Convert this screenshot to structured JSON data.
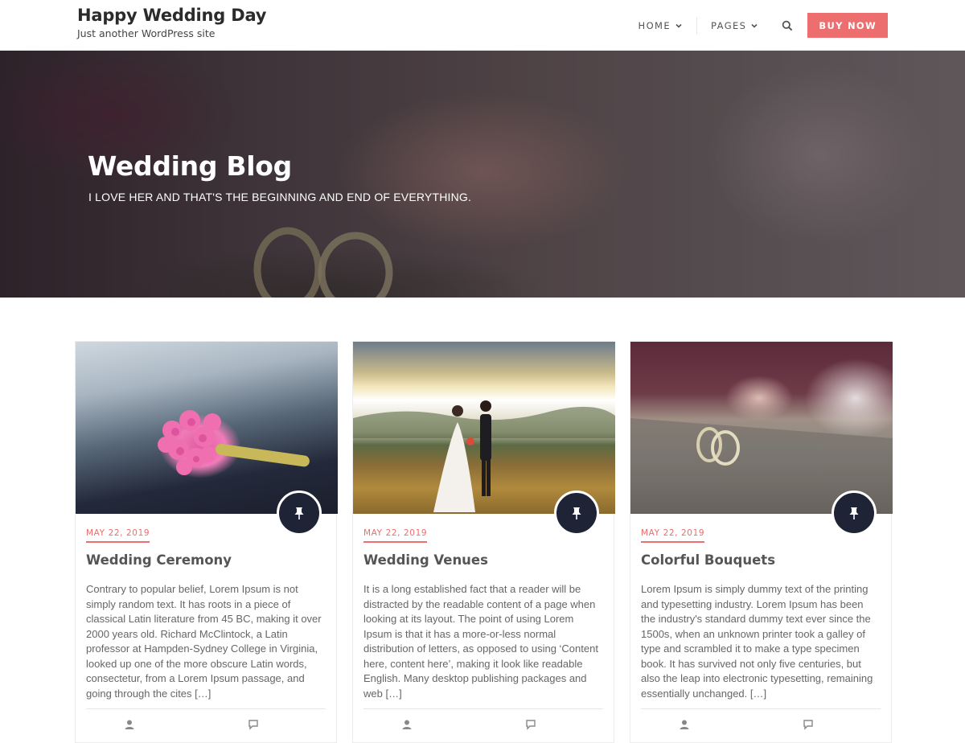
{
  "header": {
    "site_title": "Happy Wedding Day",
    "tagline": "Just another WordPress site",
    "nav": [
      {
        "label": "HOME"
      },
      {
        "label": "PAGES"
      }
    ],
    "buy_label": "BUY NOW"
  },
  "hero": {
    "title": "Wedding Blog",
    "subtitle": "I LOVE HER AND THAT'S THE BEGINNING AND END OF EVERYTHING."
  },
  "posts": [
    {
      "date": "MAY 22, 2019",
      "title": "Wedding Ceremony",
      "excerpt": "Contrary to popular belief, Lorem Ipsum is not simply random text. It has roots in a piece of classical Latin literature from 45 BC, making it over 2000 years old. Richard McClintock, a Latin professor at Hampden-Sydney College in Virginia, looked up one of the more obscure Latin words, consectetur, from a Lorem Ipsum passage, and going through the cites […]"
    },
    {
      "date": "MAY 22, 2019",
      "title": "Wedding Venues",
      "excerpt": "It is a long established fact that a reader will be distracted by the readable content of a page when looking at its layout. The point of using Lorem Ipsum is that it has a more-or-less normal distribution of letters, as opposed to using ‘Content here, content here’, making it look like readable English. Many desktop publishing packages and web […]"
    },
    {
      "date": "MAY 22, 2019",
      "title": "Colorful Bouquets",
      "excerpt": "Lorem Ipsum is simply dummy text of the printing and typesetting industry. Lorem Ipsum has been the industry's standard dummy text ever since the 1500s, when an unknown printer took a galley of type and scrambled it to make a type specimen book. It has survived not only five centuries, but also the leap into electronic typesetting, remaining essentially unchanged. […]"
    }
  ],
  "colors": {
    "accent": "#ec6e6e",
    "pin_badge": "#1f2336",
    "title_text": "#2b2b2b"
  },
  "icons": {
    "search": "search-icon",
    "nav_dropdown": "chevron-down-icon",
    "post_format": "pin-icon",
    "meta_author": "user-icon",
    "meta_comments": "comment-icon"
  }
}
